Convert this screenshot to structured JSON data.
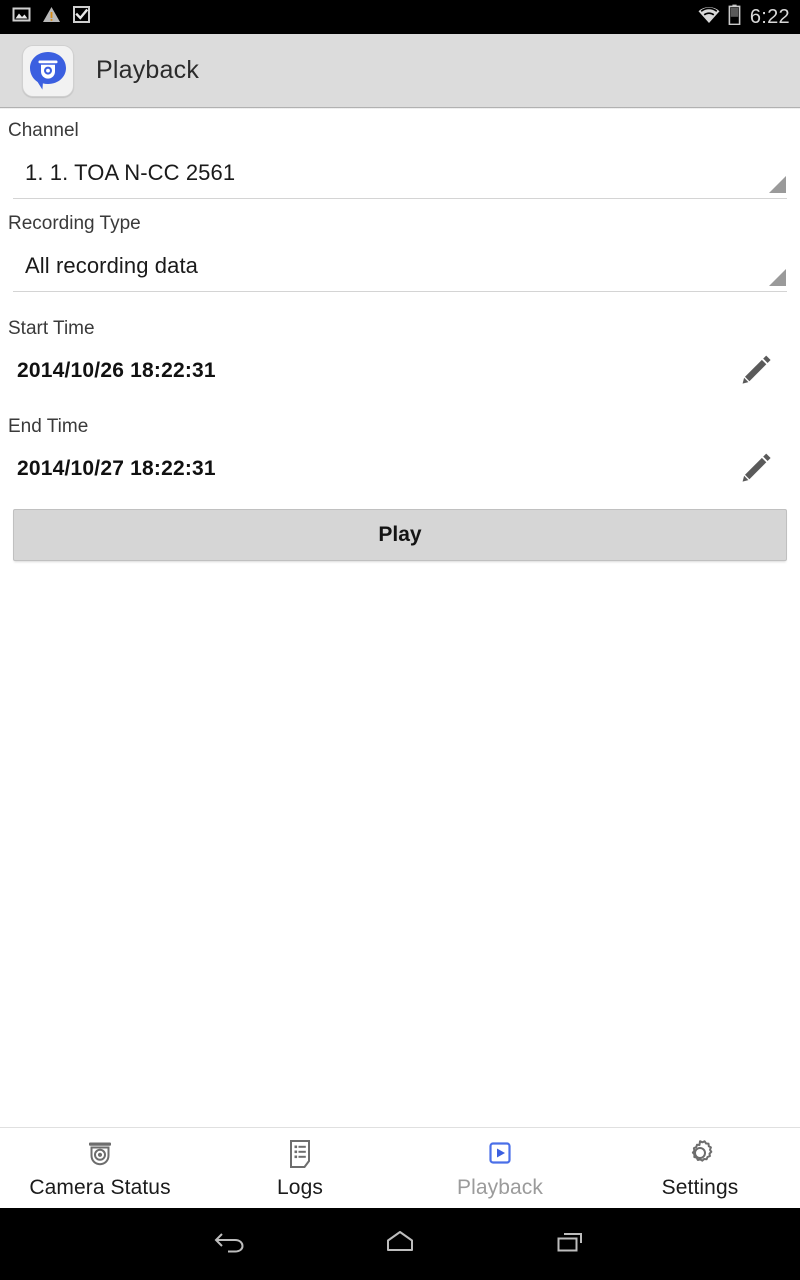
{
  "status_bar": {
    "icons": [
      "image-icon",
      "warning-triangle-icon",
      "checkbox-checked-icon"
    ],
    "wifi_icon": "wifi-icon",
    "battery_icon": "battery-icon",
    "clock": "6:22"
  },
  "action_bar": {
    "app_icon": "camera-bubble-app-icon",
    "title": "Playback"
  },
  "form": {
    "channel": {
      "label": "Channel",
      "value": "1. 1. TOA N-CC 2561",
      "dropdown_icon": "spinner-triangle-icon"
    },
    "recording_type": {
      "label": "Recording Type",
      "value": "All recording data",
      "dropdown_icon": "spinner-triangle-icon"
    },
    "start_time": {
      "label": "Start Time",
      "value": "2014/10/26 18:22:31",
      "edit_icon": "pencil-icon"
    },
    "end_time": {
      "label": "End Time",
      "value": "2014/10/27 18:22:31",
      "edit_icon": "pencil-icon"
    },
    "play_button": {
      "label": "Play"
    }
  },
  "tab_bar": {
    "tabs": [
      {
        "label": "Camera Status",
        "icon": "dome-camera-icon",
        "active": false
      },
      {
        "label": "Logs",
        "icon": "document-list-icon",
        "active": false
      },
      {
        "label": "Playback",
        "icon": "play-box-icon",
        "active": true
      },
      {
        "label": "Settings",
        "icon": "gear-icon",
        "active": false
      }
    ]
  },
  "nav_bar": {
    "back": "back-icon",
    "home": "home-icon",
    "recents": "recents-icon"
  },
  "colors": {
    "accent_blue": "#4a6fe8",
    "action_bar_bg": "#dcdcdc",
    "button_bg": "#d6d6d6",
    "tab_inactive_label": "#1b1b1b",
    "tab_active_label": "#9b9b9b"
  }
}
